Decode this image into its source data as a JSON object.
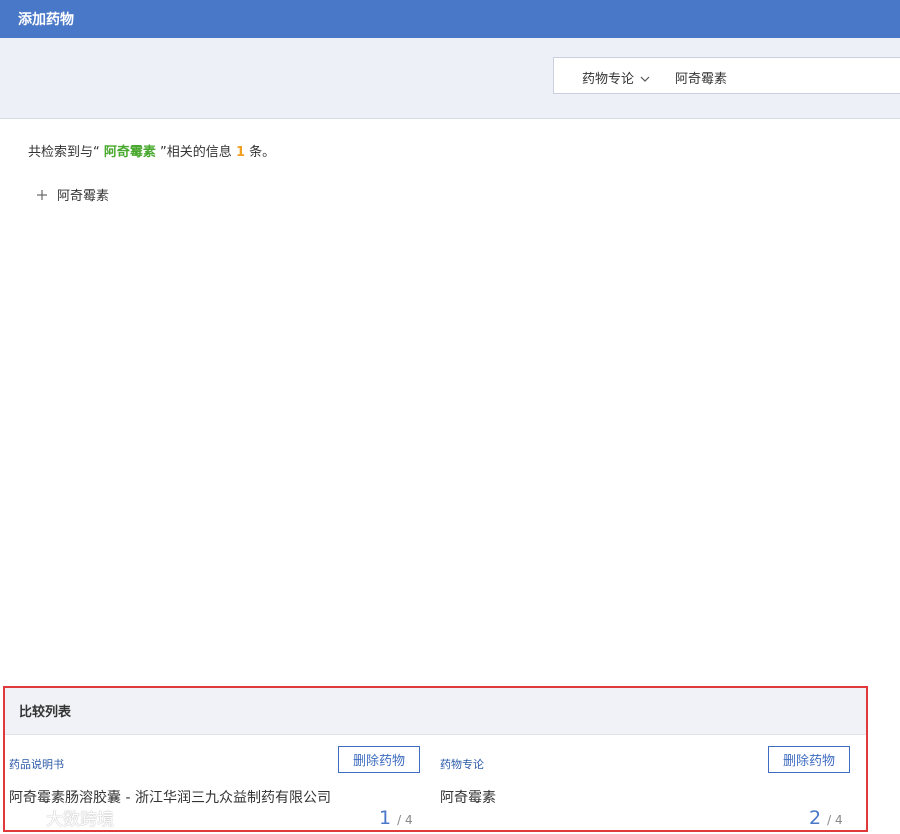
{
  "header": {
    "title": "添加药物"
  },
  "search": {
    "type_label": "药物专论",
    "value": "阿奇霉素"
  },
  "result": {
    "prefix": "共检索到与“",
    "query": "阿奇霉素",
    "middle": "”相关的信息",
    "count": "1",
    "suffix": "条。"
  },
  "tree": {
    "items": [
      {
        "label": "阿奇霉素"
      }
    ]
  },
  "compare": {
    "title": "比较列表",
    "delete_label": "删除药物",
    "slots": [
      {
        "type": "药品说明书",
        "name": "阿奇霉素肠溶胶囊 - 浙江华润三九众益制药有限公司",
        "page": "1",
        "total": "/ 4"
      },
      {
        "type": "药物专论",
        "name": "阿奇霉素",
        "page": "2",
        "total": "/ 4"
      }
    ]
  },
  "watermark": {
    "text": "大数跨境"
  },
  "colors": {
    "header_bg": "#4a78c8",
    "highlight_green": "#49a82e",
    "highlight_orange": "#f0a020",
    "frame_red": "#e0393b"
  }
}
